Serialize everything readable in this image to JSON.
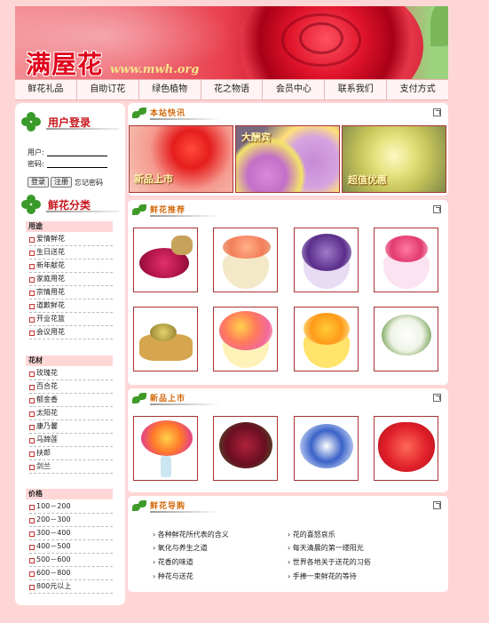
{
  "site": {
    "logo": "满屋花",
    "domain": "www.mwh.org"
  },
  "nav": [
    {
      "label": "鲜花礼品"
    },
    {
      "label": "自助订花"
    },
    {
      "label": "绿色植物"
    },
    {
      "label": "花之物语"
    },
    {
      "label": "会员中心"
    },
    {
      "label": "联系我们"
    },
    {
      "label": "支付方式"
    }
  ],
  "login": {
    "title": "用户登录",
    "user_label": "用户:",
    "pass_label": "密码:",
    "login_btn": "登录",
    "register_btn": "注册",
    "forgot": "忘记密码"
  },
  "categories": {
    "title": "鲜花分类",
    "groups": [
      {
        "name": "用途",
        "items": [
          "爱情鲜花",
          "生日送花",
          "新年献花",
          "家庭用花",
          "宗情用花",
          "道歉鲜花",
          "开业花篮",
          "会议用花"
        ]
      },
      {
        "name": "花材",
        "items": [
          "玫瑰花",
          "百合花",
          "郁金香",
          "太阳花",
          "康乃馨",
          "马蹄莲",
          "扶郎",
          "剑兰"
        ]
      },
      {
        "name": "价格",
        "items": [
          "100－200",
          "200－300",
          "300－400",
          "400－500",
          "500－600",
          "600－800",
          "800元以上"
        ]
      }
    ]
  },
  "panels": {
    "news": {
      "title": "本站快讯",
      "promos": [
        "新品上市",
        "大酬宾",
        "超值优惠"
      ]
    },
    "recommend": {
      "title": "鲜花推荐"
    },
    "new_arrivals": {
      "title": "新品上市"
    },
    "guide": {
      "title": "鲜花导购",
      "left": [
        "各种鲜花所代表的含义",
        "氧化与养生之道",
        "花香的味道",
        "种花与送花"
      ],
      "right": [
        "花的喜怒哀乐",
        "每天清晨的第一缕阳光",
        "世界各地关于送花的习俗",
        "手捧一束鲜花的等待"
      ]
    }
  },
  "colors": {
    "accent_red": "#c7161d",
    "panel_title": "#d2680a",
    "page_bg": "#ffd6d6"
  }
}
